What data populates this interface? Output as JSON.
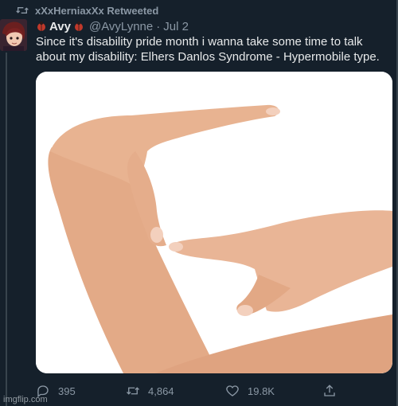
{
  "retweet": {
    "label": "xXxHerniaxXx Retweeted",
    "icon": "retweet-icon"
  },
  "tweet": {
    "author_name": "Avy",
    "author_handle": "@AvyLynne",
    "separator": "·",
    "date": "Jul 2",
    "name_emoji_icon": "ladybug-icon",
    "text": "Since it's disability pride month i wanna take some time to talk about my disability: Elhers Danlos Syndrome - Hypermobile type.",
    "media_icon": "hypermobile-hand-photo"
  },
  "actions": {
    "reply_count": "395",
    "retweet_count": "4,864",
    "like_count": "19.8K"
  },
  "watermark": "imgflip.com",
  "colors": {
    "background": "#15202b",
    "primary_text": "#e7e9ea",
    "secondary_text": "#8b98a5",
    "divider": "#38444d"
  }
}
